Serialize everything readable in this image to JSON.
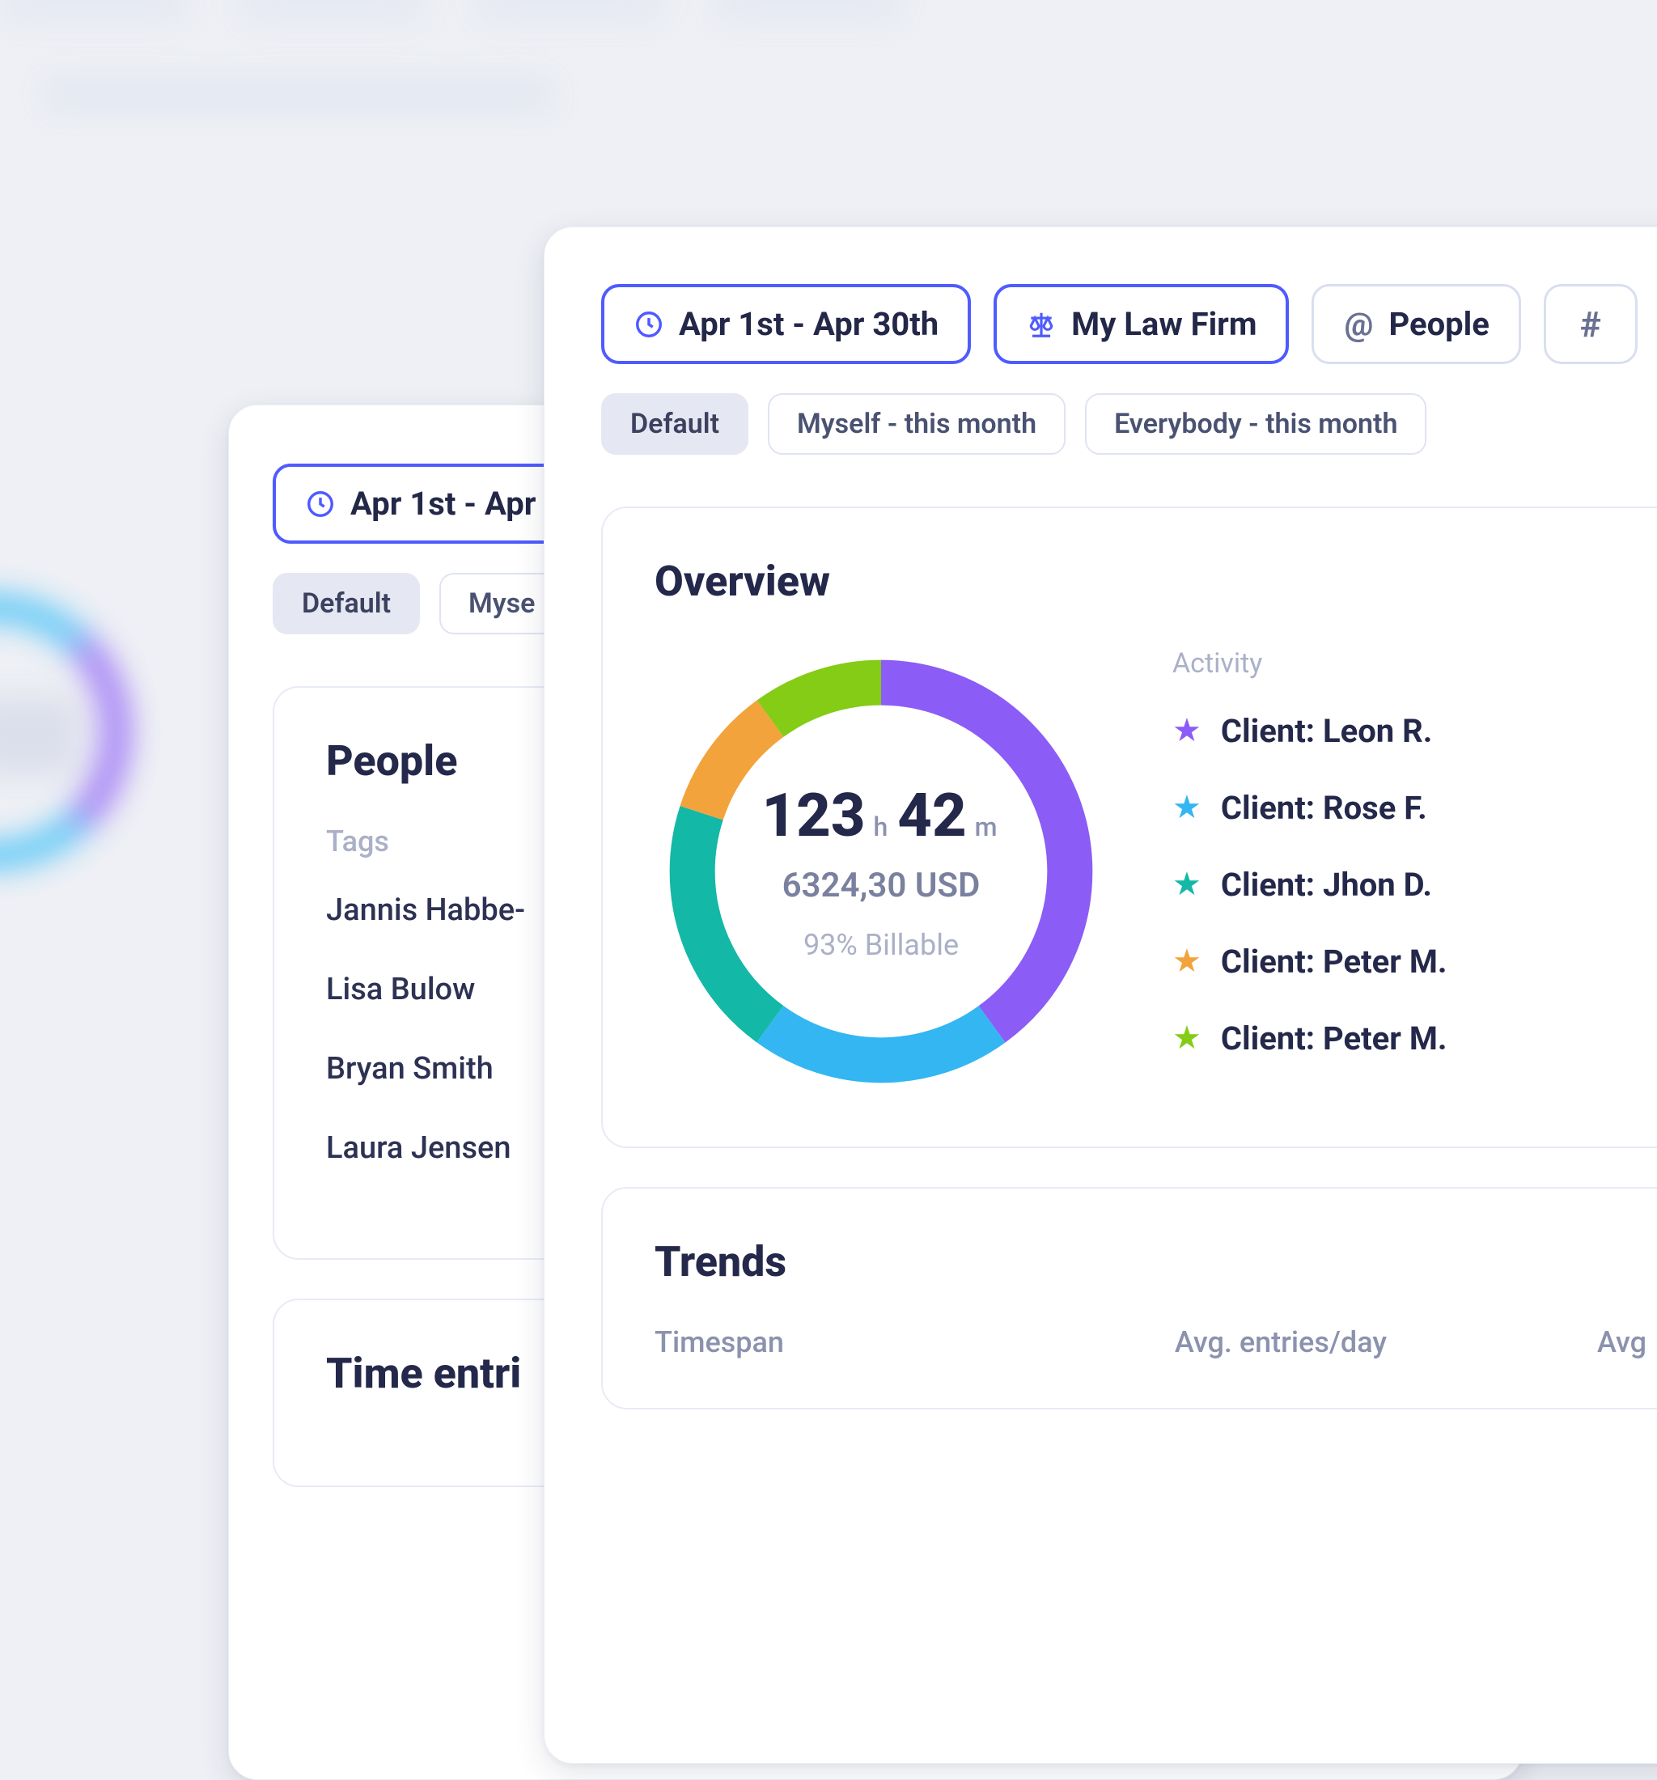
{
  "colors": {
    "purple": "#8b5cf6",
    "blue": "#33b6f2",
    "teal": "#14b8a6",
    "orange": "#f2a33c",
    "green": "#84cc16"
  },
  "filters": {
    "date": "Apr 1st - Apr 30th",
    "firm": "My Law Firm",
    "people": "People",
    "tags_glyph": "#"
  },
  "presets": {
    "default": "Default",
    "myself": "Myself - this month",
    "everybody": "Everybody - this month"
  },
  "mid": {
    "date": "Apr 1st - Apr",
    "preset_default": "Default",
    "preset_myself_short": "Myse",
    "people_title": "People",
    "tags_label": "Tags",
    "people": [
      "Jannis Habbe-",
      "Lisa Bulow",
      "Bryan Smith",
      "Laura Jensen"
    ],
    "time_entries_title": "Time entri"
  },
  "overview": {
    "title": "Overview",
    "hours": "123",
    "h_unit": "h",
    "minutes": "42",
    "m_unit": "m",
    "amount": "6324,30 USD",
    "billable": "93%  Billable",
    "activity_label": "Activity",
    "legend": [
      {
        "label": "Client: Leon R.",
        "color": "#8b5cf6"
      },
      {
        "label": "Client: Rose F.",
        "color": "#33b6f2"
      },
      {
        "label": "Client: Jhon D.",
        "color": "#14b8a6"
      },
      {
        "label": "Client: Peter M.",
        "color": "#f2a33c"
      },
      {
        "label": "Client: Peter M.",
        "color": "#84cc16"
      }
    ]
  },
  "trends": {
    "title": "Trends",
    "timespan": "Timespan",
    "avg_entries": "Avg. entries/day",
    "avg_short": "Avg"
  },
  "chart_data": {
    "type": "pie",
    "title": "Overview",
    "series": [
      {
        "name": "Client: Leon R.",
        "value": 40,
        "color": "#8b5cf6"
      },
      {
        "name": "Client: Rose F.",
        "value": 20,
        "color": "#33b6f2"
      },
      {
        "name": "Client: Jhon D.",
        "value": 20,
        "color": "#14b8a6"
      },
      {
        "name": "Client: Peter M.",
        "value": 10,
        "color": "#f2a33c"
      },
      {
        "name": "Client: Peter M.",
        "value": 10,
        "color": "#84cc16"
      }
    ],
    "center_labels": {
      "time_hours": 123,
      "time_minutes": 42,
      "amount": "6324,30 USD",
      "billable_pct": 93
    }
  }
}
